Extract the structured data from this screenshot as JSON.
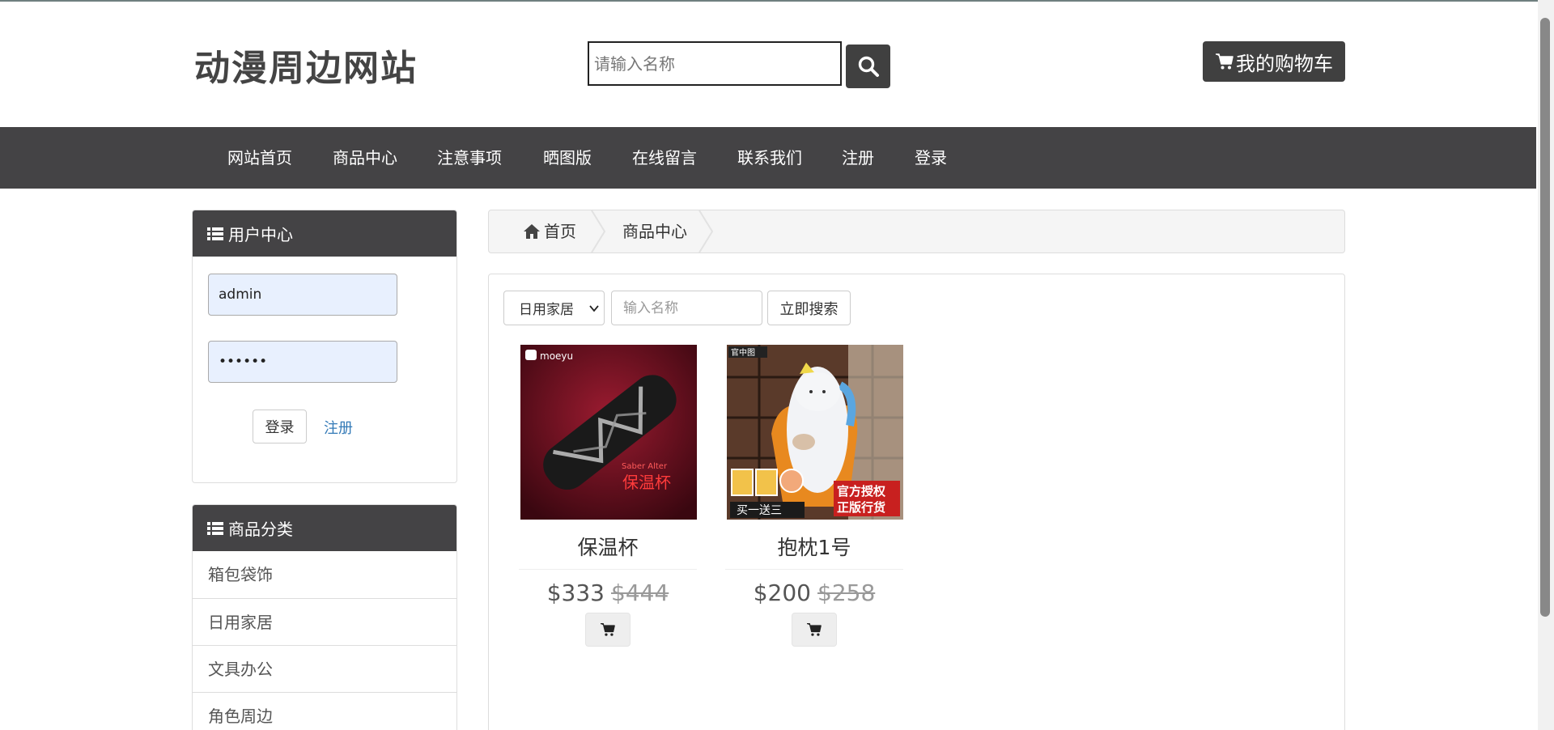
{
  "header": {
    "site_title": "动漫周边网站",
    "search_placeholder": "请输入名称",
    "cart_label": "我的购物车"
  },
  "nav": {
    "items": [
      "网站首页",
      "商品中心",
      "注意事项",
      "晒图版",
      "在线留言",
      "联系我们",
      "注册",
      "登录"
    ]
  },
  "user_center": {
    "title": "用户中心",
    "username_value": "admin",
    "password_value": "••••••",
    "login_label": "登录",
    "register_label": "注册"
  },
  "categories": {
    "title": "商品分类",
    "items": [
      "箱包袋饰",
      "日用家居",
      "文具办公",
      "角色周边"
    ]
  },
  "breadcrumb": {
    "home": "首页",
    "current": "商品中心"
  },
  "filter": {
    "selected_category": "日用家居",
    "name_placeholder": "输入名称",
    "search_label": "立即搜索"
  },
  "products": [
    {
      "name": "保温杯",
      "price": "$333",
      "old_price": "$444",
      "image_brand": "moeyu",
      "image_text_1": "Saber Alter",
      "image_text_2": "保温杯"
    },
    {
      "name": "抱枕1号",
      "price": "$200",
      "old_price": "$258",
      "image_badge_1": "官方授权",
      "image_badge_2": "正版行货",
      "image_promo": "买一送三",
      "image_logo": "官中图"
    }
  ],
  "colors": {
    "dark_bar": "#444345",
    "link_blue": "#337ab7",
    "autofill_blue": "#e8f0fe"
  },
  "icons": [
    "search-icon",
    "cart-icon",
    "list-icon",
    "home-icon",
    "chevron-down-icon"
  ]
}
